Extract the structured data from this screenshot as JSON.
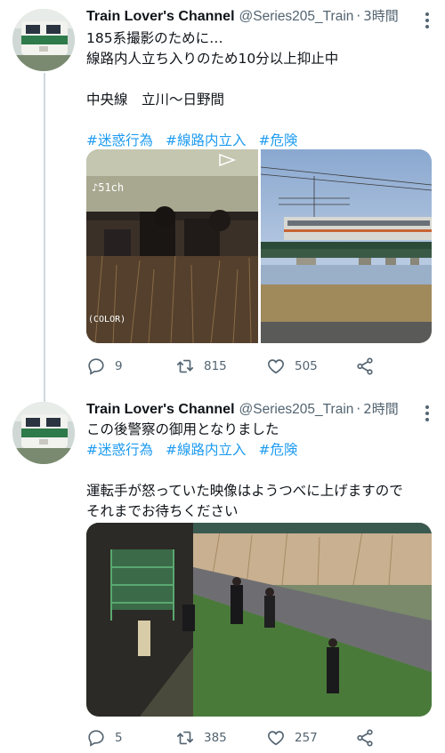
{
  "tweets": [
    {
      "author": {
        "name": "Train Lover's Channel",
        "handle": "@Series205_Train"
      },
      "time": "3時間",
      "lines": [
        "185系撮影のために…",
        "線路内人立ち入りのため10分以上抑止中",
        "",
        "中央線　立川〜日野間"
      ],
      "hashtags": [
        "#迷惑行為",
        "#線路内立入",
        "#危険"
      ],
      "media": [
        {
          "caption": "♪51ch",
          "sub": "(COLOR)"
        },
        {
          "caption": ""
        }
      ],
      "stats": {
        "replies": "9",
        "retweets": "815",
        "likes": "505"
      }
    },
    {
      "author": {
        "name": "Train Lover's Channel",
        "handle": "@Series205_Train"
      },
      "time": "2時間",
      "lines": [
        "この後警察の御用となりました"
      ],
      "hashtags": [
        "#迷惑行為",
        "#線路内立入",
        "#危険"
      ],
      "lines2": [
        "運転手が怒っていた映像はようつべに上げますので",
        "それまでお待ちください"
      ],
      "stats": {
        "replies": "5",
        "retweets": "385",
        "likes": "257"
      }
    }
  ],
  "icons": [
    "reply-icon",
    "retweet-icon",
    "like-icon",
    "share-icon",
    "more-icon"
  ],
  "colors": {
    "link": "#1d9bf0",
    "secondary": "#536471",
    "thread": "#cfd9de"
  }
}
